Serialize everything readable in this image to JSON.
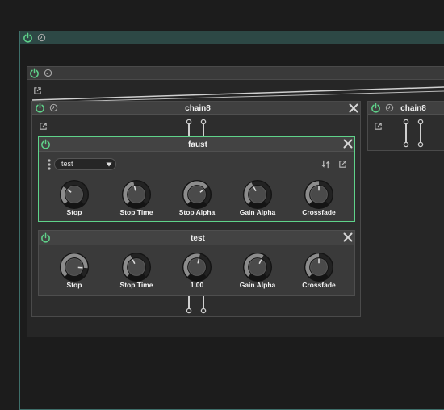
{
  "colors": {
    "accent": "#5fd38a",
    "outer_border": "#3e6f6a",
    "panel": "#3a3a3a",
    "header": "#404040",
    "body": "#2b2b2b"
  },
  "root": {
    "power_icon": "power-icon",
    "reset_icon": "reset-icon"
  },
  "chain_outer": {
    "power_icon": "power-icon"
  },
  "chain_main": {
    "title": "chain8"
  },
  "chain_side": {
    "title": "chain8"
  },
  "faust": {
    "title": "faust",
    "preset_select": "test",
    "knobs": [
      {
        "label": "Stop",
        "value": 0.3
      },
      {
        "label": "Stop Time",
        "value": 0.45
      },
      {
        "label": "Stop Alpha",
        "value": 0.7
      },
      {
        "label": "Gain Alpha",
        "value": 0.4
      },
      {
        "label": "Crossfade",
        "value": 0.5
      }
    ]
  },
  "test": {
    "title": "test",
    "knobs": [
      {
        "label": "Stop",
        "value": 0.85
      },
      {
        "label": "Stop Time",
        "value": 0.4
      },
      {
        "label": "1.00",
        "value": 0.55
      },
      {
        "label": "Gain Alpha",
        "value": 0.6
      },
      {
        "label": "Crossfade",
        "value": 0.5
      }
    ]
  }
}
